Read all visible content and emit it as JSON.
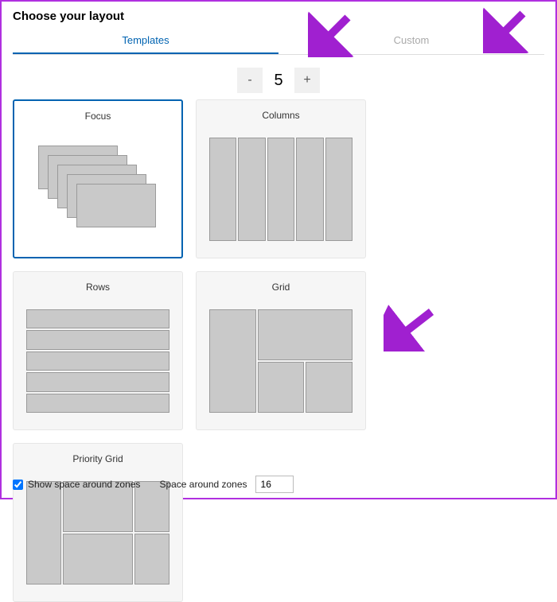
{
  "title": "Choose your layout",
  "tabs": {
    "templates": "Templates",
    "custom": "Custom"
  },
  "stepper": {
    "minus": "-",
    "value": "5",
    "plus": "+"
  },
  "cards": {
    "focus": "Focus",
    "columns": "Columns",
    "rows": "Rows",
    "grid": "Grid",
    "priority": "Priority Grid"
  },
  "footer": {
    "show_space": "Show space around zones",
    "space_label": "Space around zones",
    "space_value": "16"
  }
}
